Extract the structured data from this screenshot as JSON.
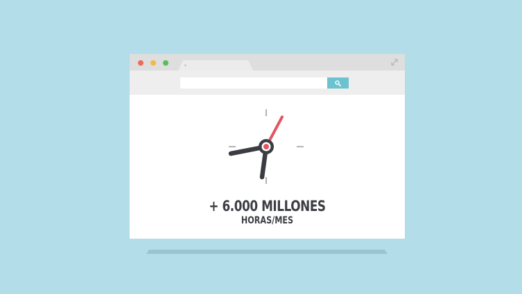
{
  "window": {
    "traffic_lights": {
      "close": "#ee6a5c",
      "minimize": "#f2b94a",
      "maximize": "#54c157"
    },
    "search": {
      "value": "",
      "placeholder": ""
    },
    "accent": "#6cc3cf"
  },
  "content": {
    "headline": "+ 6.000 MILLONES",
    "subline": "HORAS/MES",
    "clock": {
      "hand_color": "#3b3d43",
      "second_hand_color": "#e25561"
    }
  },
  "background": "#b3dde8"
}
